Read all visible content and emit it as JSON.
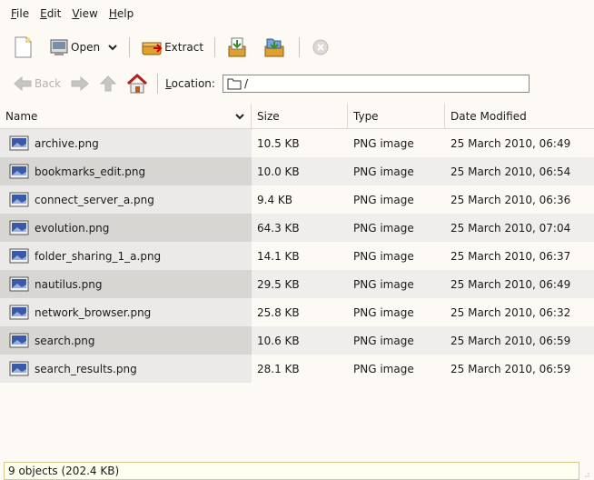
{
  "menu": {
    "items": [
      {
        "accel": "F",
        "rest": "ile"
      },
      {
        "accel": "E",
        "rest": "dit"
      },
      {
        "accel": "V",
        "rest": "iew"
      },
      {
        "accel": "H",
        "rest": "elp"
      }
    ]
  },
  "toolbar": {
    "open_label": "Open",
    "extract_label": "Extract"
  },
  "nav": {
    "back_label": "Back",
    "location_accel": "L",
    "location_rest": "ocation:",
    "location_value": "/"
  },
  "columns": {
    "name": "Name",
    "size": "Size",
    "type": "Type",
    "date": "Date Modified"
  },
  "files": [
    {
      "name": "archive.png",
      "size": "10.5 KB",
      "type": "PNG image",
      "date": "25 March 2010, 06:49"
    },
    {
      "name": "bookmarks_edit.png",
      "size": "10.0 KB",
      "type": "PNG image",
      "date": "25 March 2010, 06:54"
    },
    {
      "name": "connect_server_a.png",
      "size": "9.4 KB",
      "type": "PNG image",
      "date": "25 March 2010, 06:36"
    },
    {
      "name": "evolution.png",
      "size": "64.3 KB",
      "type": "PNG image",
      "date": "25 March 2010, 07:04"
    },
    {
      "name": "folder_sharing_1_a.png",
      "size": "14.1 KB",
      "type": "PNG image",
      "date": "25 March 2010, 06:37"
    },
    {
      "name": "nautilus.png",
      "size": "29.5 KB",
      "type": "PNG image",
      "date": "25 March 2010, 06:49"
    },
    {
      "name": "network_browser.png",
      "size": "25.8 KB",
      "type": "PNG image",
      "date": "25 March 2010, 06:32"
    },
    {
      "name": "search.png",
      "size": "10.6 KB",
      "type": "PNG image",
      "date": "25 March 2010, 06:59"
    },
    {
      "name": "search_results.png",
      "size": "28.1 KB",
      "type": "PNG image",
      "date": "25 March 2010, 06:59"
    }
  ],
  "status": {
    "text": "9 objects (202.4 KB)"
  },
  "icons": {
    "new": "new-archive-icon",
    "open": "open-icon",
    "extract": "extract-icon",
    "add_files": "add-files-icon",
    "add_folder": "add-folder-icon",
    "stop": "stop-icon",
    "back": "back-arrow-icon",
    "forward": "forward-arrow-icon",
    "up": "up-arrow-icon",
    "home": "home-icon",
    "folder": "folder-icon",
    "image_file": "image-file-icon"
  }
}
